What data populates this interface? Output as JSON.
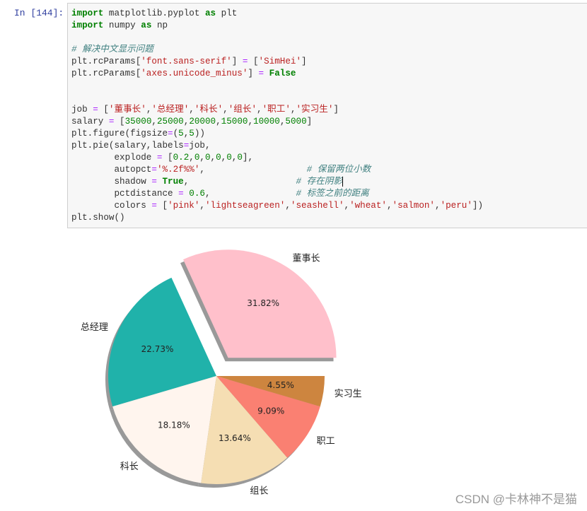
{
  "cell": {
    "prompt": "In  [144]:",
    "lines": [
      [
        {
          "t": "import",
          "c": "kw"
        },
        {
          "t": " matplotlib.pyplot ",
          "c": ""
        },
        {
          "t": "as",
          "c": "kw"
        },
        {
          "t": " plt",
          "c": ""
        }
      ],
      [
        {
          "t": "import",
          "c": "kw"
        },
        {
          "t": " numpy ",
          "c": ""
        },
        {
          "t": "as",
          "c": "kw"
        },
        {
          "t": " np",
          "c": ""
        }
      ],
      [],
      [
        {
          "t": "# 解决中文显示问题",
          "c": "cm"
        }
      ],
      [
        {
          "t": "plt.rcParams[",
          "c": ""
        },
        {
          "t": "'font.sans-serif'",
          "c": "str"
        },
        {
          "t": "] ",
          "c": ""
        },
        {
          "t": "=",
          "c": "op"
        },
        {
          "t": " [",
          "c": ""
        },
        {
          "t": "'SimHei'",
          "c": "str"
        },
        {
          "t": "]",
          "c": ""
        }
      ],
      [
        {
          "t": "plt.rcParams[",
          "c": ""
        },
        {
          "t": "'axes.unicode_minus'",
          "c": "str"
        },
        {
          "t": "] ",
          "c": ""
        },
        {
          "t": "=",
          "c": "op"
        },
        {
          "t": " ",
          "c": ""
        },
        {
          "t": "False",
          "c": "kw"
        }
      ],
      [],
      [],
      [
        {
          "t": "job ",
          "c": ""
        },
        {
          "t": "=",
          "c": "op"
        },
        {
          "t": " [",
          "c": ""
        },
        {
          "t": "'董事长'",
          "c": "str"
        },
        {
          "t": ",",
          "c": ""
        },
        {
          "t": "'总经理'",
          "c": "str"
        },
        {
          "t": ",",
          "c": ""
        },
        {
          "t": "'科长'",
          "c": "str"
        },
        {
          "t": ",",
          "c": ""
        },
        {
          "t": "'组长'",
          "c": "str"
        },
        {
          "t": ",",
          "c": ""
        },
        {
          "t": "'职工'",
          "c": "str"
        },
        {
          "t": ",",
          "c": ""
        },
        {
          "t": "'实习生'",
          "c": "str"
        },
        {
          "t": "]",
          "c": ""
        }
      ],
      [
        {
          "t": "salary ",
          "c": ""
        },
        {
          "t": "=",
          "c": "op"
        },
        {
          "t": " [",
          "c": ""
        },
        {
          "t": "35000",
          "c": "num"
        },
        {
          "t": ",",
          "c": ""
        },
        {
          "t": "25000",
          "c": "num"
        },
        {
          "t": ",",
          "c": ""
        },
        {
          "t": "20000",
          "c": "num"
        },
        {
          "t": ",",
          "c": ""
        },
        {
          "t": "15000",
          "c": "num"
        },
        {
          "t": ",",
          "c": ""
        },
        {
          "t": "10000",
          "c": "num"
        },
        {
          "t": ",",
          "c": ""
        },
        {
          "t": "5000",
          "c": "num"
        },
        {
          "t": "]",
          "c": ""
        }
      ],
      [
        {
          "t": "plt.figure(figsize",
          "c": ""
        },
        {
          "t": "=",
          "c": "op"
        },
        {
          "t": "(",
          "c": ""
        },
        {
          "t": "5",
          "c": "num"
        },
        {
          "t": ",",
          "c": ""
        },
        {
          "t": "5",
          "c": "num"
        },
        {
          "t": "))",
          "c": ""
        }
      ],
      [
        {
          "t": "plt.pie(salary,labels",
          "c": ""
        },
        {
          "t": "=",
          "c": "op"
        },
        {
          "t": "job,",
          "c": ""
        }
      ],
      [
        {
          "t": "        explode ",
          "c": ""
        },
        {
          "t": "=",
          "c": "op"
        },
        {
          "t": " [",
          "c": ""
        },
        {
          "t": "0.2",
          "c": "num"
        },
        {
          "t": ",",
          "c": ""
        },
        {
          "t": "0",
          "c": "num"
        },
        {
          "t": ",",
          "c": ""
        },
        {
          "t": "0",
          "c": "num"
        },
        {
          "t": ",",
          "c": ""
        },
        {
          "t": "0",
          "c": "num"
        },
        {
          "t": ",",
          "c": ""
        },
        {
          "t": "0",
          "c": "num"
        },
        {
          "t": ",",
          "c": ""
        },
        {
          "t": "0",
          "c": "num"
        },
        {
          "t": "],",
          "c": ""
        }
      ],
      [
        {
          "t": "        autopct",
          "c": ""
        },
        {
          "t": "=",
          "c": "op"
        },
        {
          "t": "'%.2f%%'",
          "c": "str"
        },
        {
          "t": ",                   ",
          "c": ""
        },
        {
          "t": "# 保留两位小数",
          "c": "cm"
        }
      ],
      [
        {
          "t": "        shadow ",
          "c": ""
        },
        {
          "t": "=",
          "c": "op"
        },
        {
          "t": " ",
          "c": ""
        },
        {
          "t": "True",
          "c": "kw"
        },
        {
          "t": ",                    ",
          "c": ""
        },
        {
          "t": "# 存在阴影",
          "c": "cm"
        },
        {
          "t": "",
          "c": "cursor"
        }
      ],
      [
        {
          "t": "        pctdistance ",
          "c": ""
        },
        {
          "t": "=",
          "c": "op"
        },
        {
          "t": " ",
          "c": ""
        },
        {
          "t": "0.6",
          "c": "num"
        },
        {
          "t": ",                ",
          "c": ""
        },
        {
          "t": "# 标签之前的距离",
          "c": "cm"
        }
      ],
      [
        {
          "t": "        colors ",
          "c": ""
        },
        {
          "t": "=",
          "c": "op"
        },
        {
          "t": " [",
          "c": ""
        },
        {
          "t": "'pink'",
          "c": "str"
        },
        {
          "t": ",",
          "c": ""
        },
        {
          "t": "'lightseagreen'",
          "c": "str"
        },
        {
          "t": ",",
          "c": ""
        },
        {
          "t": "'seashell'",
          "c": "str"
        },
        {
          "t": ",",
          "c": ""
        },
        {
          "t": "'wheat'",
          "c": "str"
        },
        {
          "t": ",",
          "c": ""
        },
        {
          "t": "'salmon'",
          "c": "str"
        },
        {
          "t": ",",
          "c": ""
        },
        {
          "t": "'peru'",
          "c": "str"
        },
        {
          "t": "])",
          "c": ""
        }
      ],
      [
        {
          "t": "plt.show()",
          "c": ""
        }
      ]
    ]
  },
  "chart_data": {
    "type": "pie",
    "title": "",
    "labels": [
      "董事长",
      "总经理",
      "科长",
      "组长",
      "职工",
      "实习生"
    ],
    "values": [
      35000,
      25000,
      20000,
      15000,
      10000,
      5000
    ],
    "percent_labels": [
      "31.82%",
      "22.73%",
      "18.18%",
      "13.64%",
      "9.09%",
      "4.55%"
    ],
    "colors": [
      "#ffc0cb",
      "#20b2aa",
      "#fff5ee",
      "#f5deb3",
      "#fa8072",
      "#cd853f"
    ],
    "explode": [
      0.2,
      0,
      0,
      0,
      0,
      0
    ],
    "shadow": true,
    "pctdistance": 0.6,
    "startangle": 0,
    "counterclock": true
  },
  "watermark": "CSDN @卡林神不是猫"
}
